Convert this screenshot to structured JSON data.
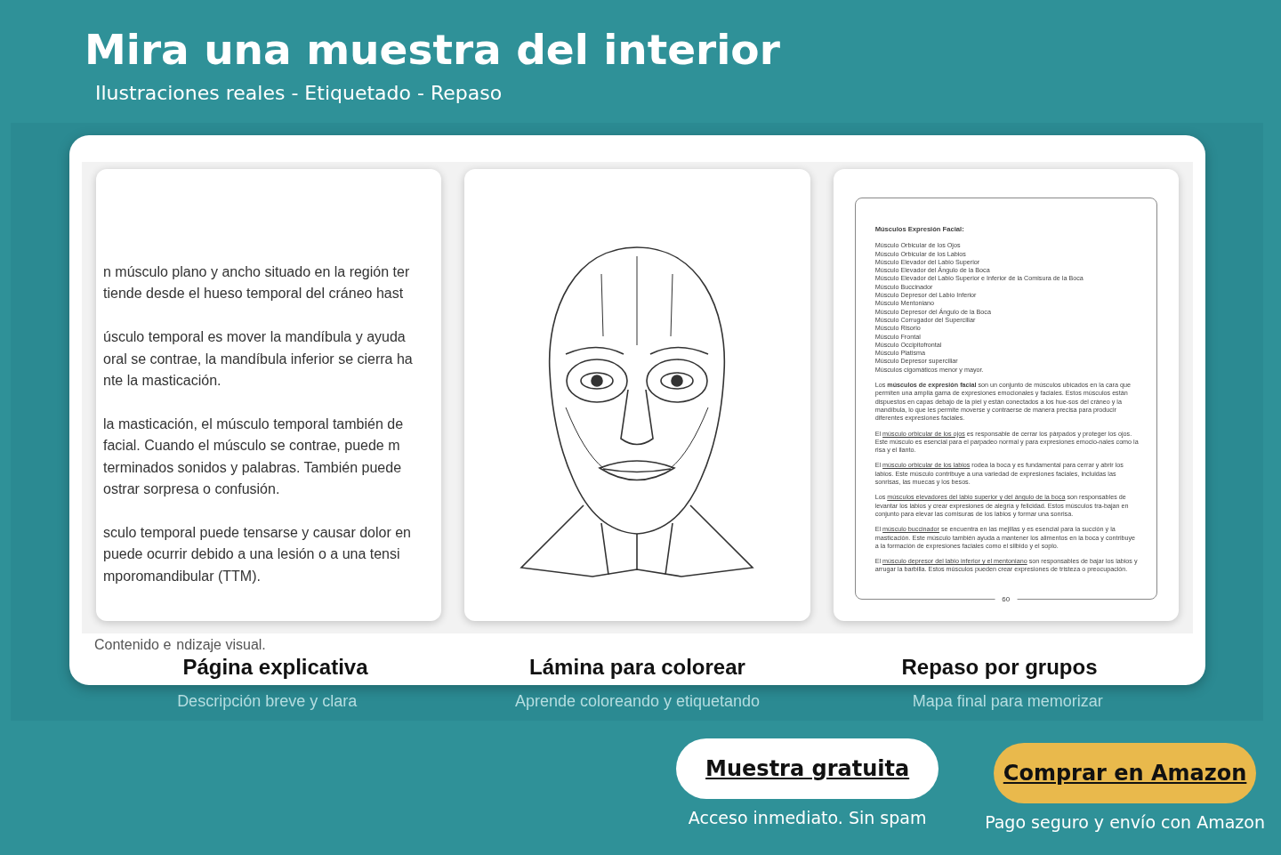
{
  "header": {
    "title": "Mira una muestra del interior",
    "subtitle": "Ilustraciones reales - Etiquetado - Repaso"
  },
  "note": [
    "Contenido e",
    "ndizaje visual."
  ],
  "pages": [
    {
      "kind": "text",
      "caption": "Página explicativa",
      "subcaption": "Descripción breve y clara",
      "paragraphs": [
        [
          "n músculo plano y ancho situado en la región ter",
          "tiende desde el hueso temporal del cráneo hast"
        ],
        [
          "úsculo temporal es mover la mandíbula y ayuda",
          "oral se contrae, la mandíbula inferior se cierra ha",
          "nte la masticación."
        ],
        [
          "la masticación, el músculo temporal también de",
          "facial. Cuando el músculo se contrae, puede m",
          "terminados sonidos y palabras. También puede",
          "ostrar sorpresa o confusión."
        ],
        [
          "sculo temporal puede tensarse y causar dolor en",
          "puede ocurrir debido a una lesión o a una tensi",
          "mporomandibular (TTM)."
        ]
      ]
    },
    {
      "kind": "drawing",
      "caption": "Lámina para colorear",
      "subcaption": "Aprende coloreando y etiquetando"
    },
    {
      "kind": "document",
      "caption": "Repaso por grupos",
      "subcaption": "Mapa final para memorizar",
      "heading": "Músculos Expresión Facial:",
      "items": [
        "Músculo Orbicular de los Ojos",
        "Músculo Orbicular de los Labios",
        "Músculo Elevador del Labio Superior",
        "Músculo Elevador del Ángulo de la Boca",
        "Músculo Elevador del Labio Superior e Inferior de la Comisura de la Boca",
        "Músculo Buccinador",
        "Músculo Depresor del Labio Inferior",
        "Músculo Mentoniano",
        "Músculo Depresor del Ángulo de la Boca",
        "Músculo Corrugador del Superciliar",
        "Músculo Risorio",
        "Músculo Frontal",
        "Músculo Occipitofrontal",
        "Músculo Platisma",
        "Músculo Depresor superciliar",
        "Músculos cigomáticos menor y mayor."
      ],
      "paragraphs": [
        {
          "text": "Los **músculos de expresión facial** son un conjunto de músculos ubicados en la cara que permiten una amplia gama de expresiones emocionales y faciales. Estos músculos están dispuestos en capas debajo de la piel y están conectados a los hue-sos del cráneo y la mandíbula, lo que les permite moverse y contraerse de manera precisa para producir diferentes expresiones faciales."
        },
        {
          "lead": "El",
          "link": "músculo orbicular de los ojos",
          "rest": "es responsable de cerrar los párpados y proteger los ojos. Este músculo es esencial para el parpadeo normal y para expresiones emocio-nales como la risa y el llanto."
        },
        {
          "lead": "El",
          "link": "músculo orbicular de los labios",
          "rest": "rodea la boca y es fundamental para cerrar y abrir los labios. Este músculo contribuye a una variedad de expresiones faciales, incluidas las sonrisas, las muecas y los besos."
        },
        {
          "lead": "Los",
          "link": "músculos elevadores del labio superior y del ángulo de la boca",
          "rest": "son responsables de levantar los labios y crear expresiones de alegría y felicidad. Estos músculos tra-bajan en conjunto para elevar las comisuras de los labios y formar una sonrisa."
        },
        {
          "lead": "El",
          "link": "músculo buccinador",
          "rest": "se encuentra en las mejillas y es esencial para la succión y la masticación. Este músculo también ayuda a mantener los alimentos en la boca y contribuye a la formación de expresiones faciales como el silbido y el soplo."
        },
        {
          "lead": "El",
          "link": "músculo depresor del labio inferior y el mentoniano",
          "rest": "son responsables de bajar los labios y arrugar la barbilla. Estos músculos pueden crear expresiones de tristeza o preocupación."
        }
      ],
      "page_number": "60"
    }
  ],
  "actions": [
    {
      "kind": "secondary",
      "label": "Muestra gratuita",
      "note": "Acceso inmediato. Sin spam"
    },
    {
      "kind": "primary",
      "label": "Comprar en Amazon",
      "note": "Pago seguro y envío con Amazon"
    }
  ]
}
